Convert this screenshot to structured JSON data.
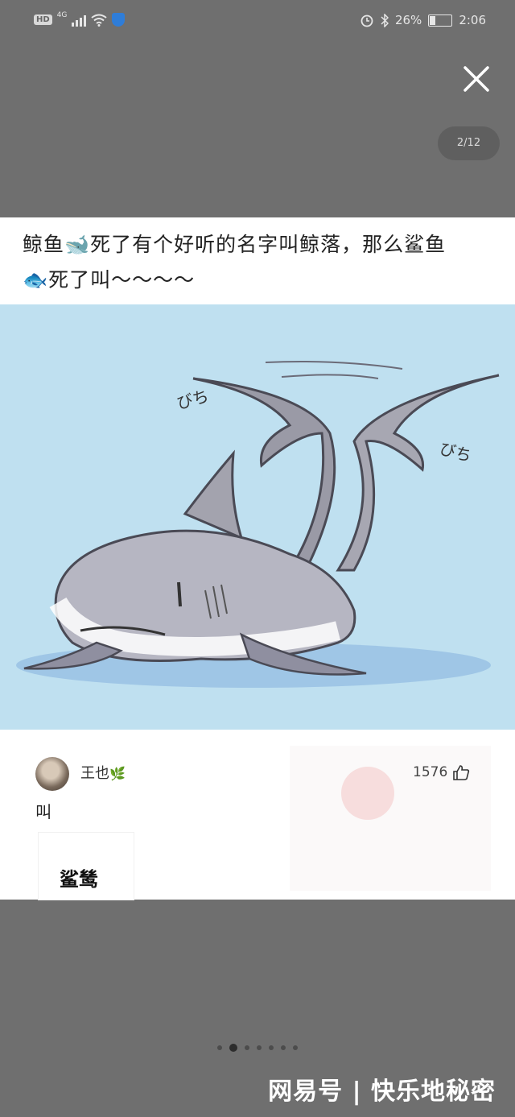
{
  "status_bar": {
    "hd": "HD",
    "network": "4G",
    "battery": "26%",
    "battery_level": 0.26,
    "time": "2:06"
  },
  "viewer": {
    "close_icon": "close-icon",
    "page_counter": "2/12"
  },
  "post": {
    "text_line1": "鲸鱼🐋死了有个好听的名字叫鲸落，那么鲨鱼",
    "text_line2": "🐟死了叫～～～～",
    "image_sfx_left": "びち",
    "image_sfx_right": "びち"
  },
  "comment": {
    "username": "王也",
    "badge_icon": "leaf-icon",
    "likes": "1576",
    "text": "叫",
    "sticker_text": "鲨鸶"
  },
  "pager": {
    "dots": 7,
    "active_index": 1
  },
  "watermark": {
    "text": "网易号 | 快乐地秘密"
  },
  "colors": {
    "background": "#6f6f6f",
    "image_bg": "#bfe0f0",
    "shield": "#2f7dd8"
  }
}
